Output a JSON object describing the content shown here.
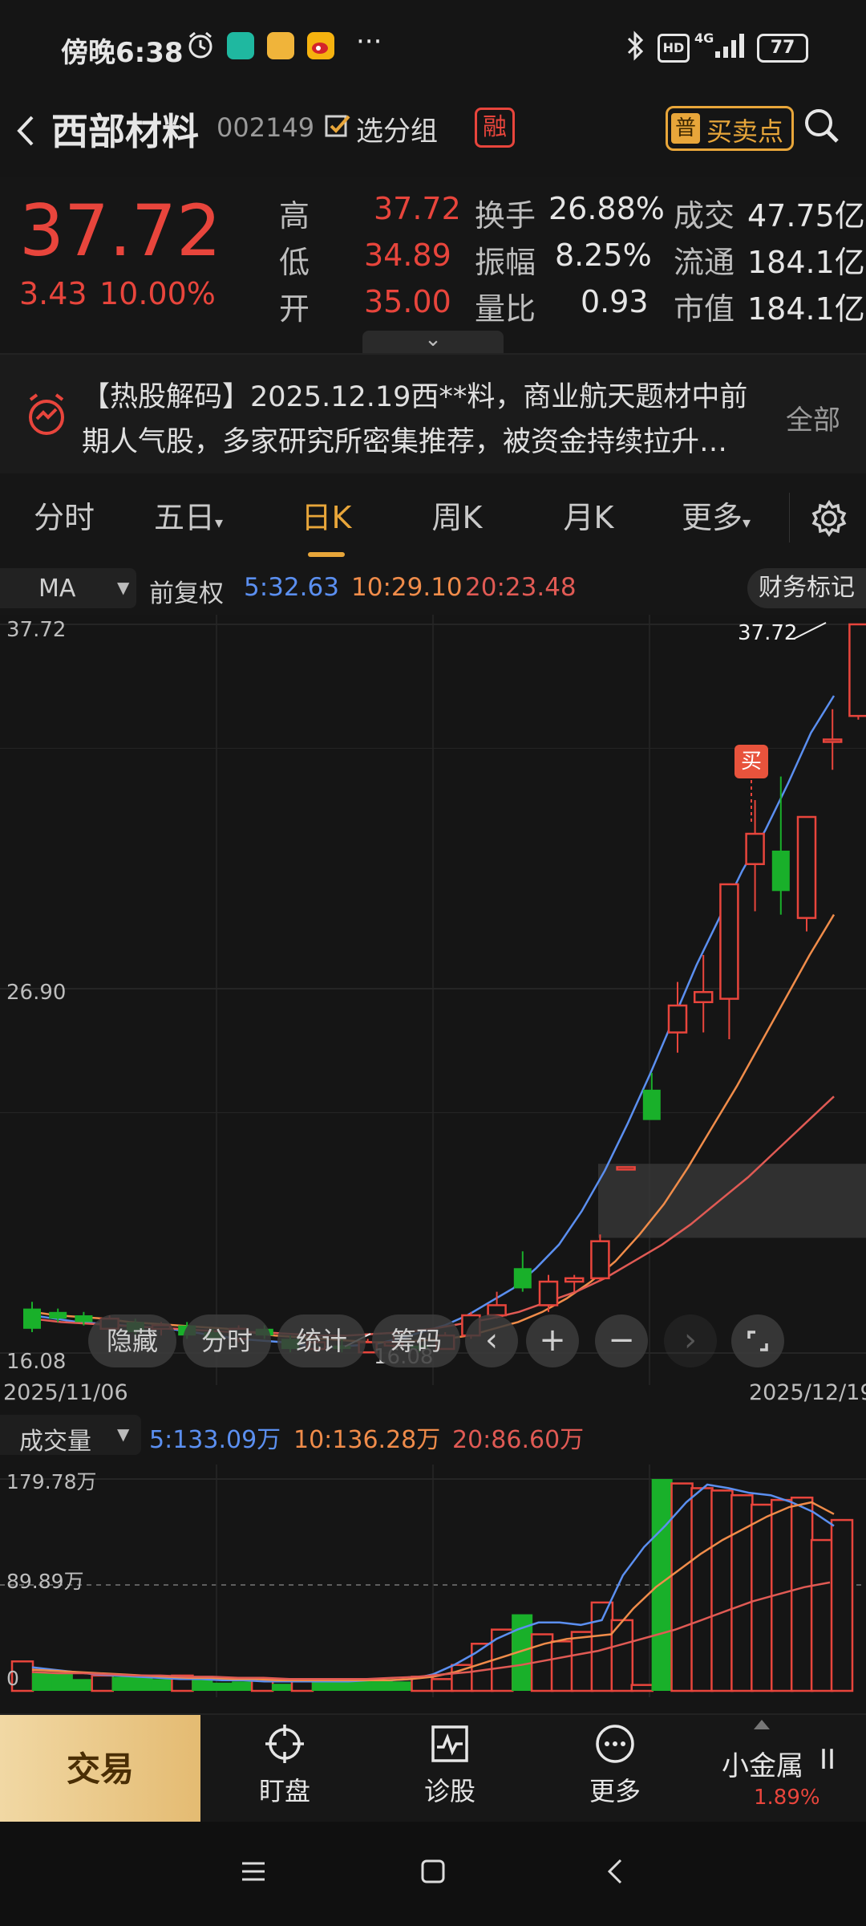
{
  "status_bar": {
    "time": "傍晚6:38",
    "more": "···",
    "net": "4G",
    "battery": "77"
  },
  "header": {
    "stock_name": "西部材料",
    "stock_code": "002149",
    "group_label": "选分组",
    "margin_badge": "融",
    "pu_badge": "普",
    "buy_sell_label": "买卖点"
  },
  "quote": {
    "price": "37.72",
    "change": "3.43",
    "change_pct": "10.00%",
    "rows": [
      {
        "l1": "高",
        "v1": "37.72",
        "l2": "换手",
        "v2": "26.88%",
        "l3": "成交",
        "v3": "47.75亿"
      },
      {
        "l1": "低",
        "v1": "34.89",
        "l2": "振幅",
        "v2": "8.25%",
        "l3": "流通",
        "v3": "184.1亿"
      },
      {
        "l1": "开",
        "v1": "35.00",
        "l2": "量比",
        "v2": "0.93",
        "l3": "市值",
        "v3": "184.1亿"
      }
    ],
    "expand": "⌄"
  },
  "news": {
    "line1": "【热股解码】2025.12.19西**料，商业航天题材中前",
    "line2": "期人气股，多家研究所密集推荐，被资金持续拉升…",
    "all_label": "全部"
  },
  "tabs": {
    "items": [
      "分时",
      "五日",
      "日K",
      "周K",
      "月K",
      "更多"
    ],
    "active": "日K",
    "dropdown": "▾"
  },
  "ma_row": {
    "ma_label": "MA",
    "caret": "▼",
    "adjust": "前复权",
    "ma5": "5:32.63",
    "ma10": "10:29.10",
    "ma20": "20:23.48",
    "finance_mark": "财务标记"
  },
  "chart_labels": {
    "y_top": "37.72",
    "y_mid": "26.90",
    "y_bottom": "16.08",
    "x_start": "2025/11/06",
    "x_end": "2025/12/19",
    "high_label": "37.72",
    "low_label": "16.08",
    "buy_marker": "买"
  },
  "overlay_buttons": {
    "hide": "隐藏",
    "timeshare": "分时",
    "stats": "统计",
    "chips": "筹码",
    "back": "‹",
    "plus": "+",
    "minus": "−",
    "forward": "›"
  },
  "volume": {
    "label": "成交量",
    "caret": "▼",
    "ma5": "5:133.09万",
    "ma10": "10:136.28万",
    "ma20": "20:86.60万",
    "y_top": "179.78万",
    "y_mid": "89.89万",
    "y_zero": "0"
  },
  "bottom_bar": {
    "trade": "交易",
    "watch": "盯盘",
    "diagnose": "诊股",
    "more": "更多",
    "sector_name": "小金属",
    "sector_pct": "1.89%"
  },
  "colors": {
    "up": "#e8453c",
    "down": "#19b02a",
    "ma5": "#5b8ff0",
    "ma10": "#f08c4a",
    "ma20": "#e05a54",
    "accent": "#e8a63a"
  },
  "chart_data": [
    {
      "type": "candlestick",
      "title": "",
      "x_range": [
        "2025/11/06",
        "2025/12/19"
      ],
      "ylim": [
        16.08,
        37.72
      ],
      "series": [
        {
          "ohlc": [
            [
              17.4,
              17.6,
              16.7,
              16.8
            ],
            [
              17.3,
              17.4,
              17.0,
              17.1
            ],
            [
              17.2,
              17.3,
              16.9,
              17.0
            ],
            [
              16.8,
              17.2,
              16.7,
              17.1
            ],
            [
              17.0,
              17.1,
              16.6,
              16.7
            ],
            [
              16.8,
              17.0,
              16.6,
              16.9
            ],
            [
              16.9,
              17.0,
              16.5,
              16.6
            ],
            [
              16.7,
              16.8,
              16.4,
              16.5
            ],
            [
              16.5,
              16.9,
              16.4,
              16.8
            ],
            [
              16.8,
              16.9,
              16.5,
              16.6
            ],
            [
              16.5,
              16.6,
              16.1,
              16.2
            ],
            [
              16.2,
              16.5,
              16.1,
              16.4
            ],
            [
              16.3,
              16.5,
              16.1,
              16.2
            ],
            [
              16.1,
              16.5,
              16.08,
              16.4
            ],
            [
              16.3,
              16.6,
              16.2,
              16.4
            ],
            [
              16.3,
              16.5,
              16.1,
              16.2
            ],
            [
              16.2,
              16.7,
              16.2,
              16.6
            ],
            [
              16.6,
              17.3,
              16.5,
              17.2
            ],
            [
              17.2,
              17.9,
              17.1,
              17.5
            ],
            [
              18.6,
              19.1,
              17.9,
              18.0
            ],
            [
              17.5,
              18.4,
              17.3,
              18.2
            ],
            [
              18.2,
              18.4,
              17.9,
              18.3
            ],
            [
              18.3,
              19.6,
              18.2,
              19.4
            ],
            [
              21.6,
              21.6,
              21.6,
              21.6
            ],
            [
              23.9,
              24.4,
              23.2,
              23.0
            ],
            [
              25.6,
              27.1,
              25.0,
              26.4
            ],
            [
              26.5,
              27.9,
              25.6,
              26.8
            ],
            [
              26.6,
              30.0,
              25.4,
              30.0
            ],
            [
              30.6,
              32.5,
              29.2,
              31.5
            ],
            [
              31.0,
              33.2,
              29.1,
              29.8
            ],
            [
              29.0,
              31.8,
              28.6,
              32.0
            ],
            [
              34.3,
              35.2,
              33.4,
              34.3
            ],
            [
              35.0,
              37.72,
              34.89,
              37.72
            ]
          ]
        }
      ],
      "ma": {
        "ma5": [
          17.2,
          17.1,
          17.0,
          16.95,
          16.9,
          16.85,
          16.8,
          16.7,
          16.6,
          16.5,
          16.45,
          16.4,
          16.3,
          16.25,
          16.3,
          16.35,
          16.5,
          16.7,
          16.9,
          17.2,
          17.6,
          18.0,
          18.6,
          19.3,
          20.3,
          21.5,
          22.9,
          24.4,
          26.0,
          27.6,
          29.0,
          30.4,
          31.6,
          33.0,
          34.5,
          35.6
        ],
        "ma10": [
          17.3,
          17.2,
          17.15,
          17.1,
          17.0,
          16.95,
          16.9,
          16.85,
          16.8,
          16.7,
          16.6,
          16.55,
          16.5,
          16.45,
          16.4,
          16.4,
          16.45,
          16.5,
          16.6,
          16.8,
          17.0,
          17.3,
          17.7,
          18.2,
          18.8,
          19.6,
          20.5,
          21.6,
          22.8,
          24.0,
          25.3,
          26.6,
          27.9,
          29.1
        ],
        "ma20": [
          17.1,
          17.0,
          16.95,
          16.9,
          16.85,
          16.8,
          16.75,
          16.7,
          16.7,
          16.65,
          16.6,
          16.6,
          16.65,
          16.7,
          16.8,
          16.95,
          17.1,
          17.3,
          17.6,
          17.9,
          18.3,
          18.8,
          19.3,
          19.9,
          20.6,
          21.3,
          22.1,
          22.9,
          23.7
        ]
      }
    },
    {
      "type": "bar",
      "title": "成交量",
      "ylim": [
        0,
        179.78
      ],
      "values": [
        25,
        15,
        15,
        10,
        13,
        12,
        12,
        10,
        13,
        10,
        7,
        8,
        10,
        6,
        9,
        10,
        8,
        10,
        10,
        8,
        12,
        10,
        22,
        40,
        52,
        65,
        48,
        42,
        50,
        75,
        60,
        5,
        182,
        176,
        172,
        170,
        166,
        158,
        162,
        164,
        128,
        145
      ],
      "up": [
        true,
        false,
        false,
        false,
        true,
        false,
        false,
        false,
        true,
        false,
        false,
        false,
        true,
        false,
        true,
        false,
        false,
        false,
        false,
        false,
        true,
        true,
        true,
        true,
        true,
        false,
        true,
        true,
        true,
        true,
        true,
        true,
        false,
        true,
        true,
        true,
        true,
        true,
        true,
        true,
        true,
        true
      ],
      "ma": {
        "ma5": [
          20,
          18,
          16,
          14,
          13,
          12,
          11,
          10,
          10,
          9,
          9,
          8,
          8,
          8,
          8,
          8,
          9,
          9,
          10,
          14,
          22,
          32,
          44,
          52,
          58,
          58,
          56,
          60,
          98,
          122,
          140,
          160,
          175,
          172,
          168,
          166,
          160,
          152,
          140
        ],
        "ma10": [
          18,
          17,
          16,
          15,
          14,
          13,
          12,
          11,
          11,
          10,
          10,
          9,
          9,
          9,
          9,
          9,
          9,
          10,
          12,
          16,
          22,
          28,
          34,
          40,
          44,
          46,
          48,
          70,
          88,
          102,
          116,
          128,
          138,
          148,
          156,
          160,
          150
        ],
        "ma20": [
          16,
          15,
          15,
          14,
          13,
          13,
          12,
          12,
          11,
          11,
          10,
          10,
          10,
          10,
          11,
          12,
          14,
          16,
          19,
          22,
          26,
          30,
          34,
          40,
          46,
          52,
          60,
          68,
          76,
          82,
          88,
          92
        ]
      }
    }
  ]
}
